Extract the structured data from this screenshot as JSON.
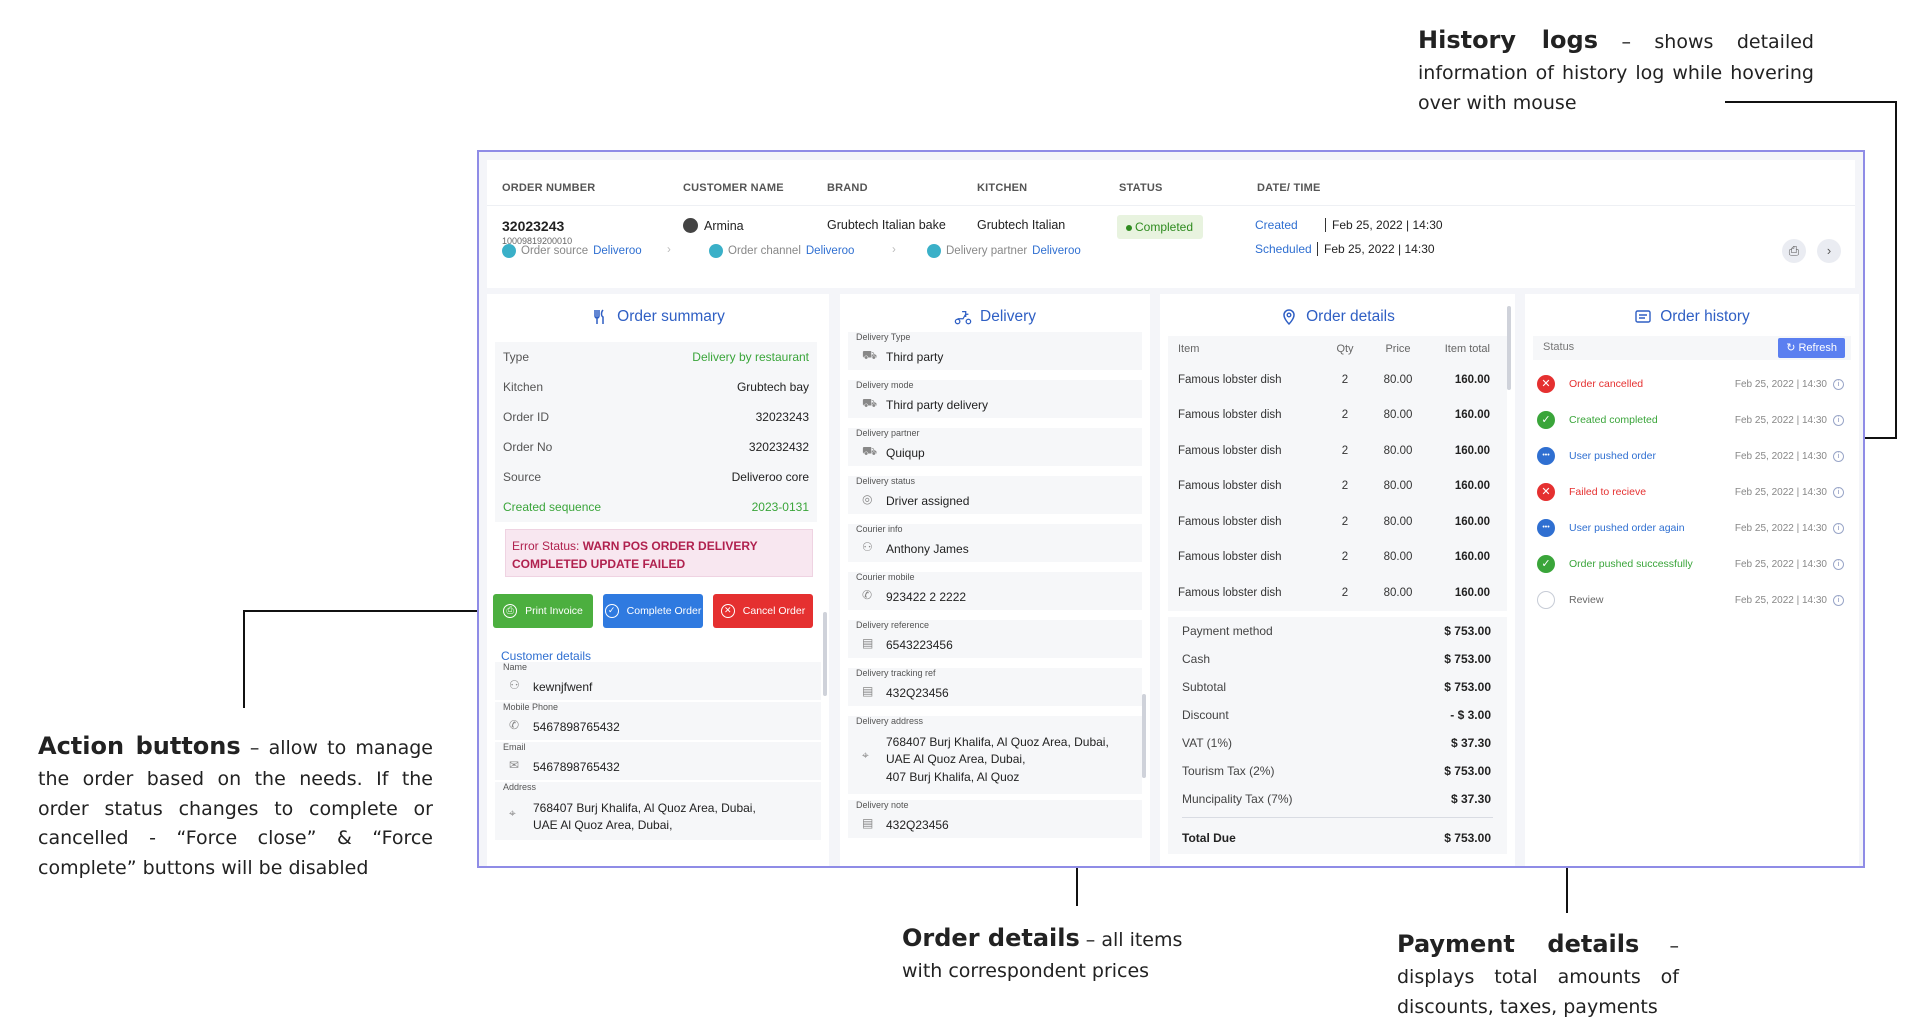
{
  "annotations": {
    "history_title": "History logs",
    "history_text": "– shows detailed information of history log while hovering over with mouse",
    "action_title": "Action buttons",
    "action_text": "– allow to manage the order based on the needs. If the order status changes to complete or cancelled - “Force close” & “Force complete” buttons will be disabled",
    "order_title": "Order details",
    "order_text": "– all items with correspondent prices",
    "payment_title": "Payment details",
    "payment_text": "– displays total amounts of discounts, taxes, payments"
  },
  "header": {
    "cols": [
      "ORDER NUMBER",
      "CUSTOMER NAME",
      "BRAND",
      "KITCHEN",
      "STATUS",
      "DATE/ TIME"
    ],
    "order_number": "32023243",
    "order_sub": "10009819200010",
    "customer": "Armina",
    "brand": "Grubtech Italian bake",
    "kitchen": "Grubtech Italian",
    "status": "Completed",
    "created_label": "Created",
    "created_date": "Feb 25, 2022 | 14:30",
    "scheduled_label": "Scheduled",
    "scheduled_date": "Feb 25, 2022 | 14:30",
    "order_source_label": "Order source",
    "order_source": "Deliveroo",
    "order_channel_label": "Order channel",
    "order_channel": "Deliveroo",
    "delivery_partner_label": "Delivery partner",
    "delivery_partner": "Deliveroo"
  },
  "summary": {
    "title": "Order summary",
    "rows": [
      {
        "k": "Type",
        "v": "Delivery by restaurant"
      },
      {
        "k": "Kitchen",
        "v": "Grubtech bay"
      },
      {
        "k": "Order ID",
        "v": "32023243"
      },
      {
        "k": "Order No",
        "v": "320232432"
      },
      {
        "k": "Source",
        "v": "Deliveroo core"
      },
      {
        "k": "Created sequence",
        "v": "2023-0131"
      }
    ],
    "error_label": "Error Status:",
    "error_text": "WARN POS ORDER DELIVERY COMPLETED UPDATE FAILED",
    "btn_print": "Print Invoice",
    "btn_complete": "Complete Order",
    "btn_cancel": "Cancel Order",
    "customer_details": "Customer details",
    "name_label": "Name",
    "name": "kewnjfwenf",
    "phone_label": "Mobile Phone",
    "phone": "5467898765432",
    "email_label": "Email",
    "email": "5467898765432",
    "address_label": "Address",
    "address1": "768407 Burj Khalifa, Al Quoz Area, Dubai,",
    "address2": "UAE  Al Quoz Area, Dubai,"
  },
  "delivery": {
    "title": "Delivery",
    "fields": [
      {
        "label": "Delivery Type",
        "value": "Third party"
      },
      {
        "label": "Delivery mode",
        "value": "Third party delivery"
      },
      {
        "label": "Delivery partner",
        "value": "Quiqup"
      },
      {
        "label": "Delivery status",
        "value": "Driver assigned"
      },
      {
        "label": "Courier info",
        "value": "Anthony James"
      },
      {
        "label": "Courier mobile",
        "value": "923422 2 2222"
      },
      {
        "label": "Delivery reference",
        "value": "6543223456"
      },
      {
        "label": "Delivery tracking ref",
        "value": "432Q23456"
      }
    ],
    "address_label": "Delivery address",
    "address1": "768407 Burj Khalifa, Al Quoz Area, Dubai,",
    "address2": "UAE  Al Quoz Area, Dubai,",
    "address3": "407 Burj Khalifa, Al Quoz",
    "note_label": "Delivery note",
    "note": "432Q23456"
  },
  "details": {
    "title": "Order details",
    "cols": [
      "Item",
      "Qty",
      "Price",
      "Item total"
    ],
    "items": [
      [
        "Famous lobster dish",
        "2",
        "80.00",
        "160.00"
      ],
      [
        "Famous lobster dish",
        "2",
        "80.00",
        "160.00"
      ],
      [
        "Famous lobster dish",
        "2",
        "80.00",
        "160.00"
      ],
      [
        "Famous lobster dish",
        "2",
        "80.00",
        "160.00"
      ],
      [
        "Famous lobster dish",
        "2",
        "80.00",
        "160.00"
      ],
      [
        "Famous lobster dish",
        "2",
        "80.00",
        "160.00"
      ],
      [
        "Famous lobster dish",
        "2",
        "80.00",
        "160.00"
      ]
    ],
    "payments": [
      [
        "Payment method",
        "$ 753.00"
      ],
      [
        "Cash",
        "$ 753.00"
      ],
      [
        "Subtotal",
        "$ 753.00"
      ],
      [
        "Discount",
        "- $ 3.00"
      ],
      [
        "VAT (1%)",
        "$ 37.30"
      ],
      [
        "Tourism Tax (2%)",
        "$ 753.00"
      ],
      [
        "Muncipality Tax (7%)",
        "$ 37.30"
      ]
    ],
    "total_label": "Total Due",
    "total": "$ 753.00"
  },
  "history": {
    "title": "Order history",
    "status_label": "Status",
    "refresh": "Refresh",
    "rows": [
      {
        "text": "Order cancelled",
        "date": "Feb 25, 2022 | 14:30",
        "kind": "red"
      },
      {
        "text": "Created completed",
        "date": "Feb 25, 2022 | 14:30",
        "kind": "green"
      },
      {
        "text": "User pushed order",
        "date": "Feb 25, 2022 | 14:30",
        "kind": "blue"
      },
      {
        "text": "Failed to recieve",
        "date": "Feb 25, 2022 | 14:30",
        "kind": "red"
      },
      {
        "text": "User pushed order again",
        "date": "Feb 25, 2022 | 14:30",
        "kind": "blue"
      },
      {
        "text": "Order pushed successfully",
        "date": "Feb 25, 2022 | 14:30",
        "kind": "green"
      },
      {
        "text": "Review",
        "date": "Feb 25, 2022 | 14:30",
        "kind": "empty"
      }
    ]
  },
  "colors": {
    "accent": "#2f5fc4",
    "green": "#3aa53a",
    "blue": "#2f6fd1",
    "red": "#e53030",
    "frame": "#8f8ce6"
  }
}
